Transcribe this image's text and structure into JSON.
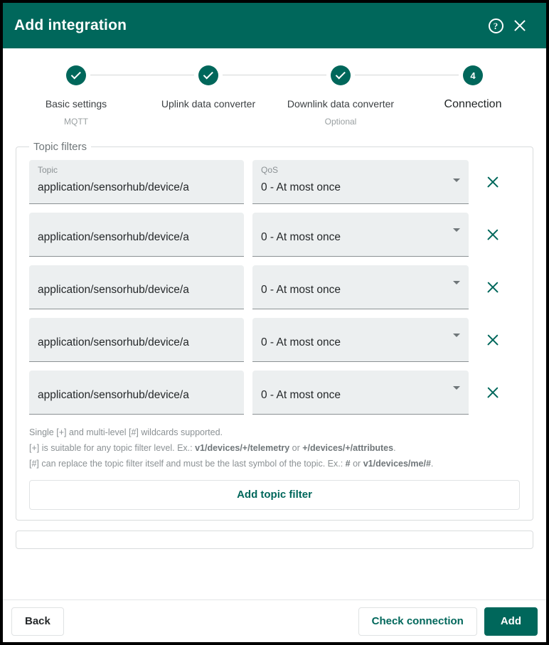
{
  "header": {
    "title": "Add integration",
    "help_icon": "help-circle-icon",
    "help_glyph": "?",
    "close_icon": "close-icon"
  },
  "accent_color": "#00675b",
  "stepper": {
    "steps": [
      {
        "index": "1",
        "label": "Basic settings",
        "sublabel": "MQTT",
        "state": "done"
      },
      {
        "index": "2",
        "label": "Uplink data converter",
        "sublabel": "",
        "state": "done"
      },
      {
        "index": "3",
        "label": "Downlink data converter",
        "sublabel": "Optional",
        "state": "done"
      },
      {
        "index": "4",
        "label": "Connection",
        "sublabel": "",
        "state": "active"
      }
    ]
  },
  "topic_filters": {
    "legend": "Topic filters",
    "topic_label": "Topic",
    "qos_label": "QoS",
    "rows": [
      {
        "topic": "application/sensorhub/device/a",
        "qos": "0 - At most once",
        "show_labels": true
      },
      {
        "topic": "application/sensorhub/device/a",
        "qos": "0 - At most once",
        "show_labels": false
      },
      {
        "topic": "application/sensorhub/device/a",
        "qos": "0 - At most once",
        "show_labels": false
      },
      {
        "topic": "application/sensorhub/device/a",
        "qos": "0 - At most once",
        "show_labels": false
      },
      {
        "topic": "application/sensorhub/device/a",
        "qos": "0 - At most once",
        "show_labels": false
      }
    ],
    "hints": [
      {
        "parts": [
          {
            "t": "Single [+] and multi-level [#] wildcards supported.",
            "b": false
          }
        ]
      },
      {
        "parts": [
          {
            "t": "[+] is suitable for any topic filter level. Ex.: ",
            "b": false
          },
          {
            "t": "v1/devices/+/telemetry",
            "b": true
          },
          {
            "t": " or ",
            "b": false
          },
          {
            "t": "+/devices/+/attributes",
            "b": true
          },
          {
            "t": ".",
            "b": false
          }
        ]
      },
      {
        "parts": [
          {
            "t": "[#] can replace the topic filter itself and must be the last symbol of the topic. Ex.: ",
            "b": false
          },
          {
            "t": "#",
            "b": true
          },
          {
            "t": " or ",
            "b": false
          },
          {
            "t": "v1/devices/me/#",
            "b": true
          },
          {
            "t": ".",
            "b": false
          }
        ]
      }
    ],
    "add_filter_label": "Add topic filter"
  },
  "footer": {
    "back_label": "Back",
    "check_connection_label": "Check connection",
    "add_label": "Add"
  }
}
